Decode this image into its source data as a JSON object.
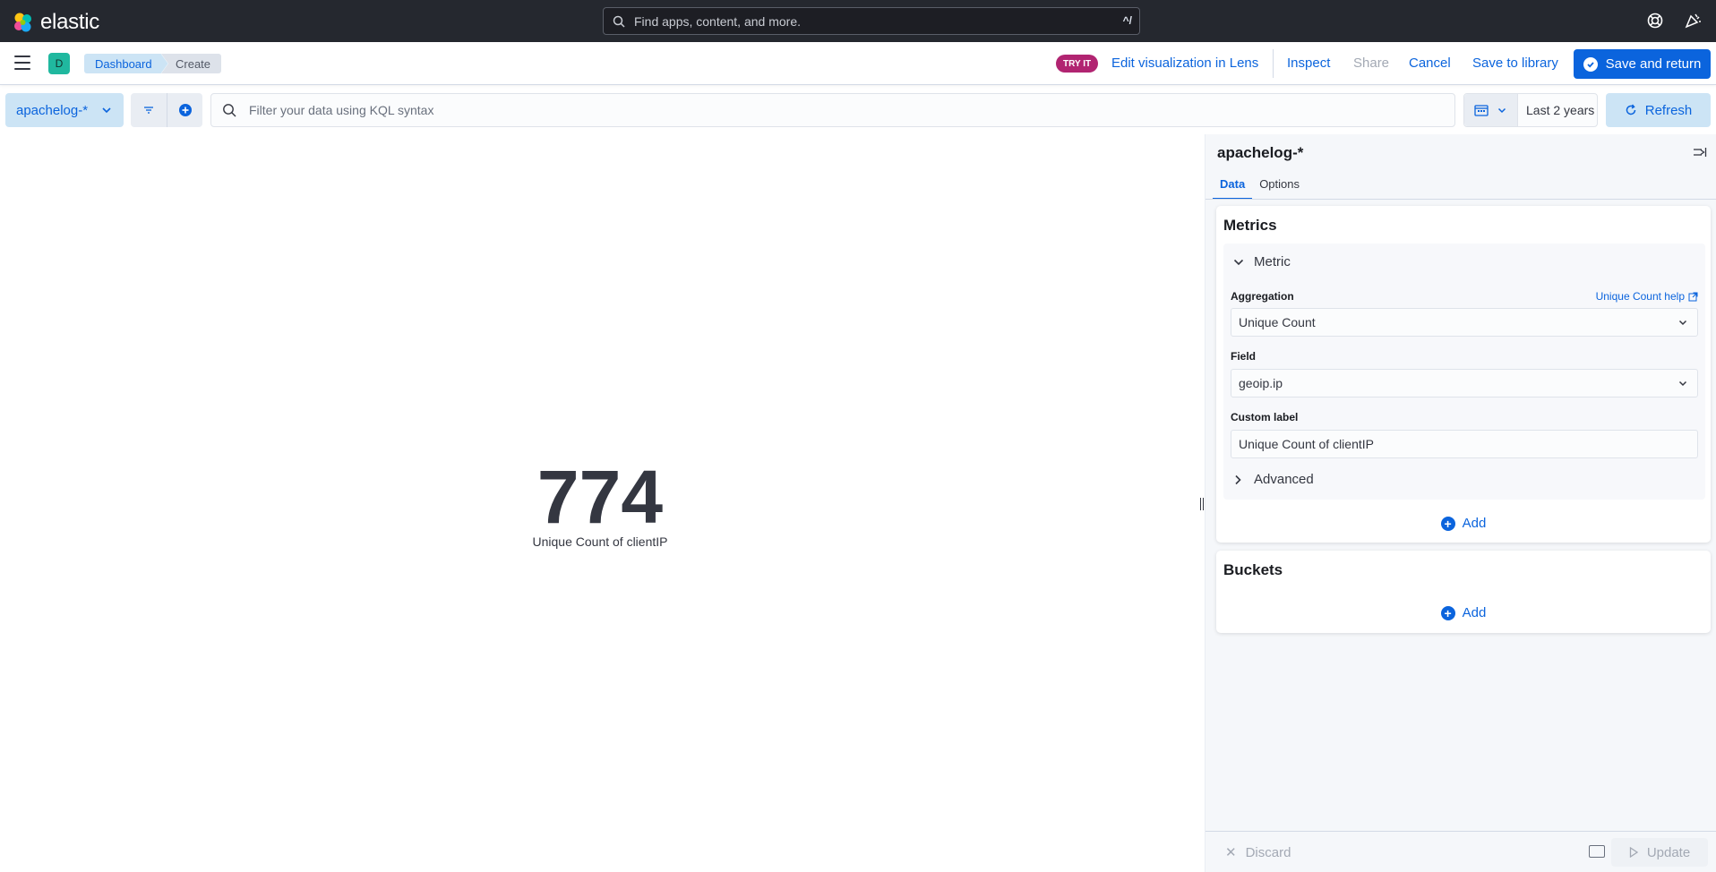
{
  "header": {
    "brand": "elastic",
    "search_placeholder": "Find apps, content, and more.",
    "search_shortcut": "^/",
    "icons": [
      "help-icon",
      "newsfeed-icon"
    ]
  },
  "nav": {
    "space_initial": "D",
    "breadcrumbs": [
      "Dashboard",
      "Create"
    ],
    "try_it_badge": "TRY IT",
    "edit_in_lens": "Edit visualization in Lens",
    "inspect": "Inspect",
    "share": "Share",
    "cancel": "Cancel",
    "save_to_library": "Save to library",
    "save_and_return": "Save and return"
  },
  "query": {
    "data_view": "apachelog-*",
    "kql_placeholder": "Filter your data using KQL syntax",
    "date_range": "Last 2 years",
    "refresh": "Refresh"
  },
  "visualization": {
    "value": "774",
    "label": "Unique Count of clientIP"
  },
  "sidebar": {
    "title": "apachelog-*",
    "tabs": [
      "Data",
      "Options"
    ],
    "active_tab": "Data",
    "metrics": {
      "title": "Metrics",
      "accordion_label": "Metric",
      "aggregation_label": "Aggregation",
      "aggregation_help": "Unique Count help",
      "aggregation_value": "Unique Count",
      "field_label": "Field",
      "field_value": "geoip.ip",
      "custom_label_label": "Custom label",
      "custom_label_value": "Unique Count of clientIP",
      "advanced_label": "Advanced",
      "add": "Add"
    },
    "buckets": {
      "title": "Buckets",
      "add": "Add"
    },
    "footer": {
      "discard": "Discard",
      "update": "Update"
    }
  },
  "colors": {
    "primary": "#0b64dd",
    "header_bg": "#25282f",
    "try_it_badge": "#b12471",
    "space_avatar": "#20b89f"
  }
}
